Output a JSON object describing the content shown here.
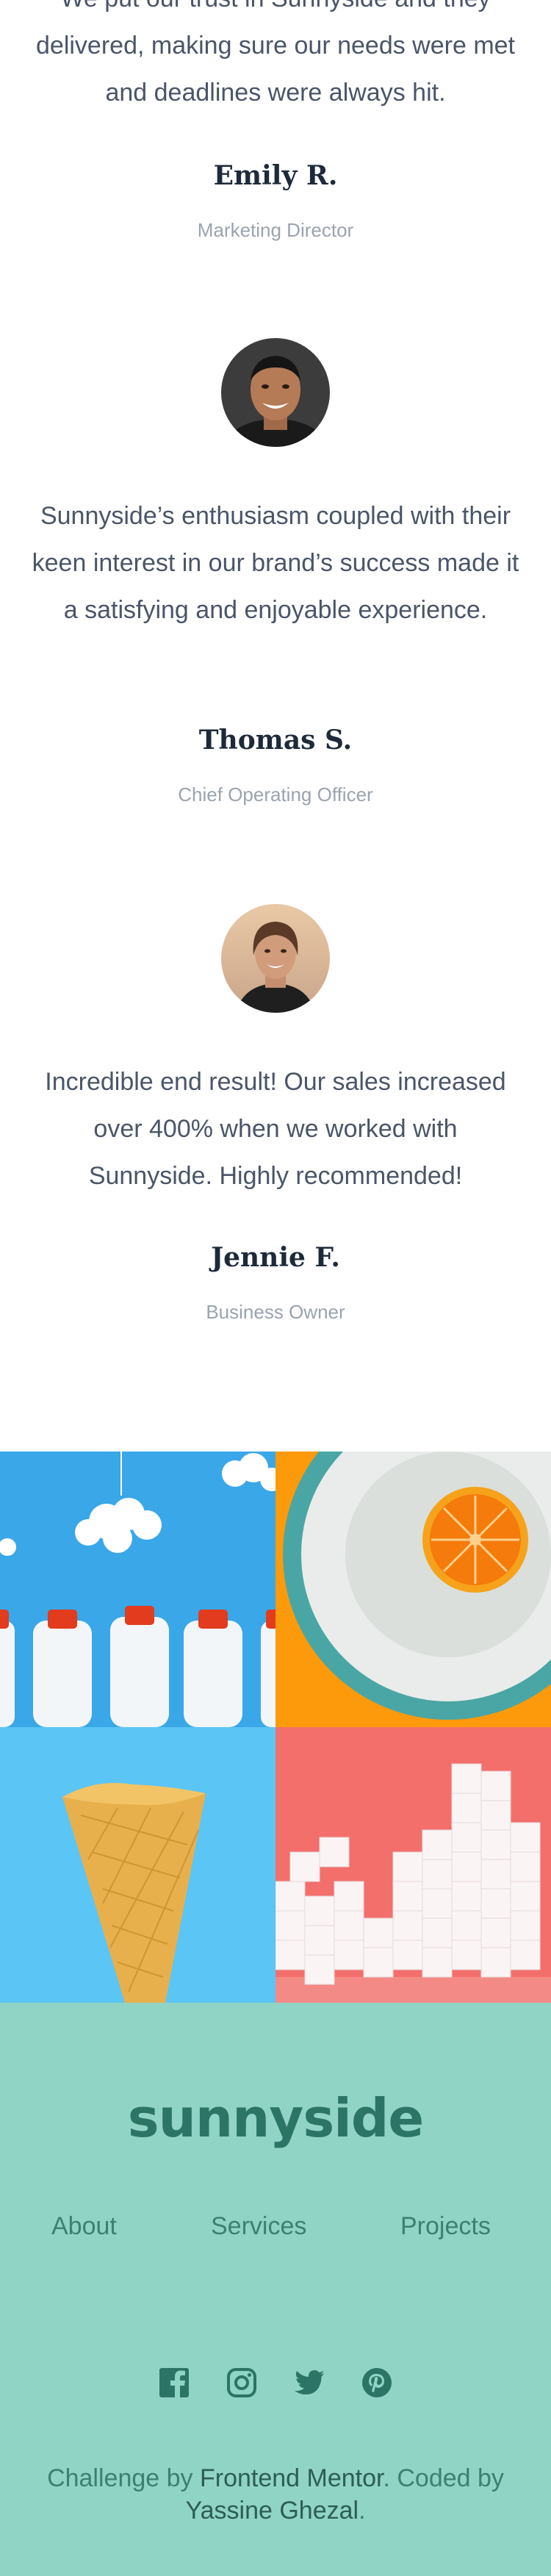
{
  "testimonials": [
    {
      "quote": "We put our trust in Sunnyside and they delivered, making sure our needs were met and deadlines were always hit.",
      "name": "Emily R.",
      "role": "Marketing Director"
    },
    {
      "quote": "Sunnyside’s enthusiasm coupled with their keen interest in our brand’s success made it a satisfying and enjoyable experience.",
      "name": "Thomas S.",
      "role": "Chief Operating Officer"
    },
    {
      "quote": "Incredible end result! Our sales increased over 400% when we worked with Sunnyside. Highly recommended!",
      "name": "Jennie F.",
      "role": "Business Owner"
    }
  ],
  "footer": {
    "logo": "sunnyside",
    "nav": [
      "About",
      "Services",
      "Projects"
    ],
    "social_icons": [
      "facebook-icon",
      "instagram-icon",
      "twitter-icon",
      "pinterest-icon"
    ],
    "credit_prefix": "Challenge by ",
    "credit_link1": "Frontend Mentor",
    "credit_mid": ". Coded by ",
    "credit_link2": "Yassine Ghezal",
    "credit_suffix": "."
  },
  "colors": {
    "footer_bg": "#90d4c5",
    "footer_text": "#3b8171",
    "logo": "#2c7566"
  }
}
